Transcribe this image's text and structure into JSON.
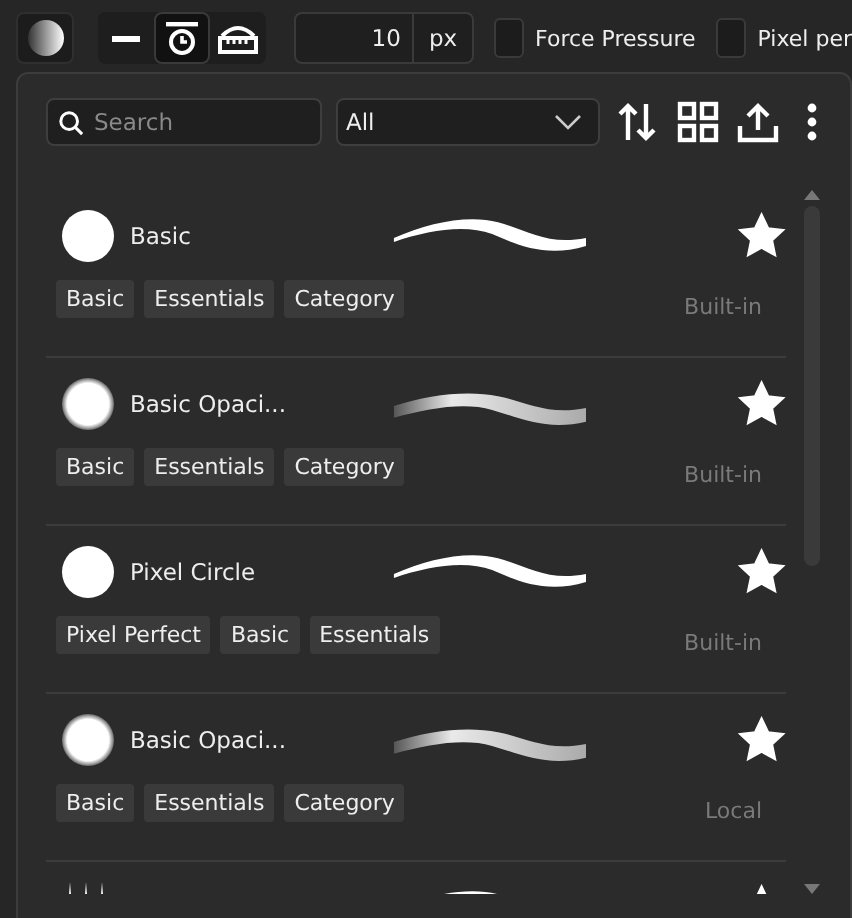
{
  "toolbar": {
    "tools": [
      {
        "kind": "line",
        "selected": false
      },
      {
        "kind": "timer",
        "selected": true
      },
      {
        "kind": "ruler",
        "selected": false
      }
    ],
    "size": {
      "value": "10",
      "unit": "px"
    },
    "checkboxes": [
      {
        "label": "Force Pressure",
        "checked": false
      },
      {
        "label": "Pixel per",
        "checked": false
      }
    ]
  },
  "panel": {
    "search": {
      "placeholder": "Search"
    },
    "filter": {
      "value": "All"
    },
    "brushes": [
      {
        "name": "Basic",
        "kind": "hard",
        "favorite": true,
        "tags": [
          "Basic",
          "Essentials",
          "Category"
        ],
        "source": "Built-in"
      },
      {
        "name": "Basic Opaci...",
        "kind": "soft",
        "favorite": true,
        "tags": [
          "Basic",
          "Essentials",
          "Category"
        ],
        "source": "Built-in"
      },
      {
        "name": "Pixel Circle",
        "kind": "hard",
        "favorite": true,
        "tags": [
          "Pixel Perfect",
          "Basic",
          "Essentials"
        ],
        "source": "Built-in"
      },
      {
        "name": "Basic Opaci...",
        "kind": "soft",
        "favorite": true,
        "tags": [
          "Basic",
          "Essentials",
          "Category"
        ],
        "source": "Local"
      },
      {
        "kind": "spikes",
        "favorite": true
      }
    ]
  }
}
